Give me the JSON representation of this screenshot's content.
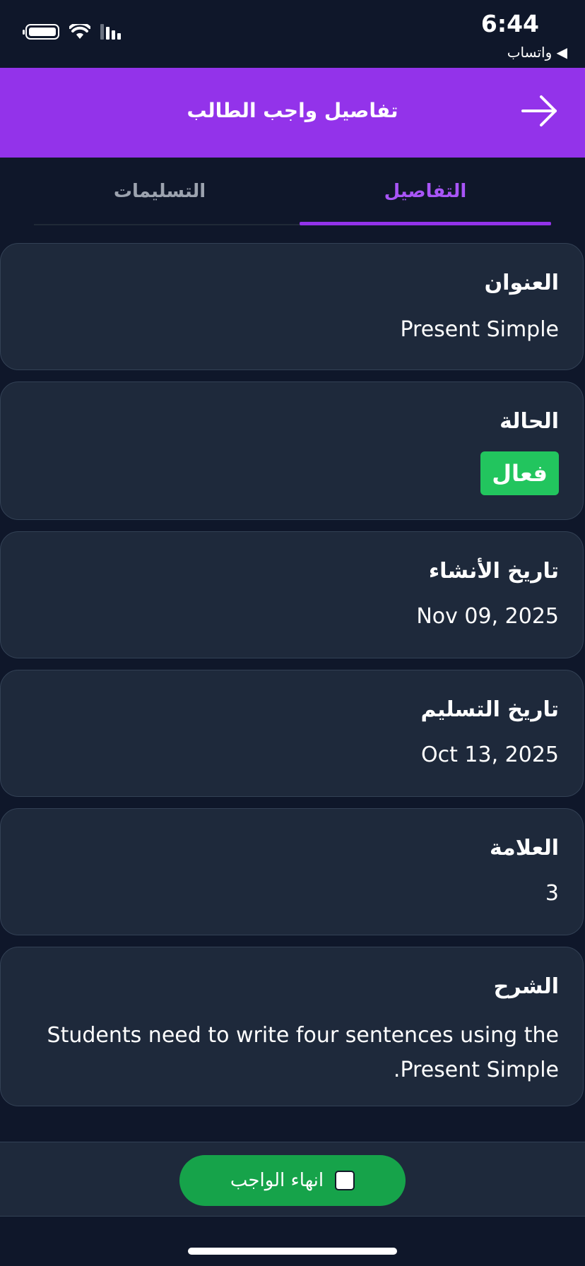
{
  "status_bar": {
    "time": "6:44",
    "back_app": "◀ واتساب",
    "icons": [
      "battery-icon",
      "wifi-icon",
      "signal-icon"
    ]
  },
  "header": {
    "title": "تفاصيل واجب الطالب",
    "back_icon": "arrow-right-icon",
    "color": "#9333ea"
  },
  "tabs": [
    {
      "label": "التفاصيل",
      "active": true
    },
    {
      "label": "التسليمات",
      "active": false
    }
  ],
  "details": {
    "title": {
      "label": "العنوان",
      "value": "Present Simple"
    },
    "status": {
      "label": "الحالة",
      "value": "فعال",
      "color": "#22c55e"
    },
    "created": {
      "label": "تاريخ الأنشاء",
      "value": "Nov 09, 2025"
    },
    "due": {
      "label": "تاريخ التسليم",
      "value": "Oct 13, 2025"
    },
    "grade": {
      "label": "العلامة",
      "value": "3"
    },
    "description": {
      "label": "الشرح",
      "value": "Students need to write four sentences using the Present Simple."
    }
  },
  "footer": {
    "finish_label": "انهاء الواجب",
    "finish_checked": false,
    "button_color": "#16a34a"
  }
}
